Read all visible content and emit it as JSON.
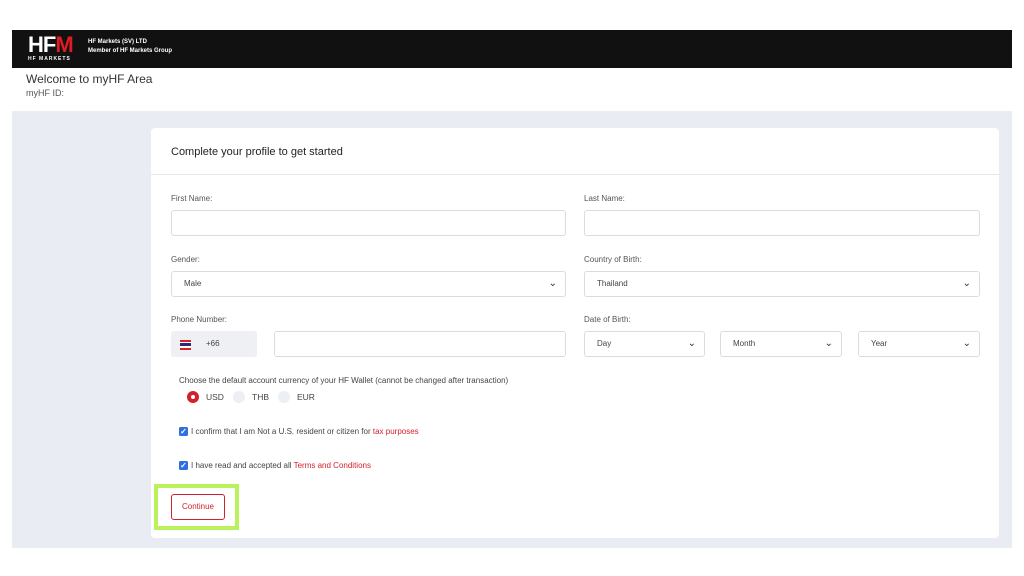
{
  "header": {
    "logo_main": "HF",
    "logo_accent": "M",
    "logo_sub": "HF MARKETS",
    "company_line1": "HF Markets (SV) LTD",
    "company_line2": "Member of HF Markets Group"
  },
  "welcome": {
    "title": "Welcome to myHF Area",
    "id_label": "myHF ID:"
  },
  "form": {
    "title": "Complete your profile to get started",
    "first_name_label": "First Name:",
    "first_name_value": "",
    "last_name_label": "Last Name:",
    "last_name_value": "",
    "gender_label": "Gender:",
    "gender_value": "Male",
    "country_label": "Country of Birth:",
    "country_value": "Thailand",
    "phone_label": "Phone Number:",
    "phone_prefix": "+66",
    "phone_value": "",
    "dob_label": "Date of Birth:",
    "dob_day": "Day",
    "dob_month": "Month",
    "dob_year": "Year",
    "currency_question": "Choose the default account currency of your HF Wallet (cannot be changed after transaction)",
    "currency_options": [
      "USD",
      "THB",
      "EUR"
    ],
    "currency_selected": "USD",
    "confirm_us_text": "I confirm that I am Not a U.S. resident or citizen for",
    "confirm_us_link": "tax purposes",
    "terms_text": "I have read and accepted all",
    "terms_link": "Terms and Conditions",
    "continue_label": "Continue"
  },
  "icons": {
    "dropdown": "chevron-down-icon",
    "flag": "thailand-flag-icon",
    "checkbox": "checkmark-icon"
  },
  "colors": {
    "brand_red": "#d1222c",
    "checkbox_blue": "#2f6fe0",
    "highlight_green": "#b9f25a",
    "header_black": "#111111"
  }
}
